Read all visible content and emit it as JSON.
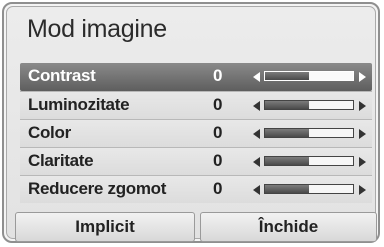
{
  "dialog": {
    "title": "Mod imagine",
    "settings": [
      {
        "label": "Contrast",
        "value": "0",
        "level": 0.5,
        "selected": true
      },
      {
        "label": "Luminozitate",
        "value": "0",
        "level": 0.5,
        "selected": false
      },
      {
        "label": "Color",
        "value": "0",
        "level": 0.5,
        "selected": false
      },
      {
        "label": "Claritate",
        "value": "0",
        "level": 0.5,
        "selected": false
      },
      {
        "label": "Reducere zgomot",
        "value": "0",
        "level": 0.5,
        "selected": false
      }
    ],
    "buttons": {
      "default_label": "Implicit",
      "close_label": "Închide"
    }
  },
  "colors": {
    "selected_row": "#6e6e6e",
    "panel_bg": "#e4e4e4",
    "slider_fill": "#5a5a5a"
  }
}
